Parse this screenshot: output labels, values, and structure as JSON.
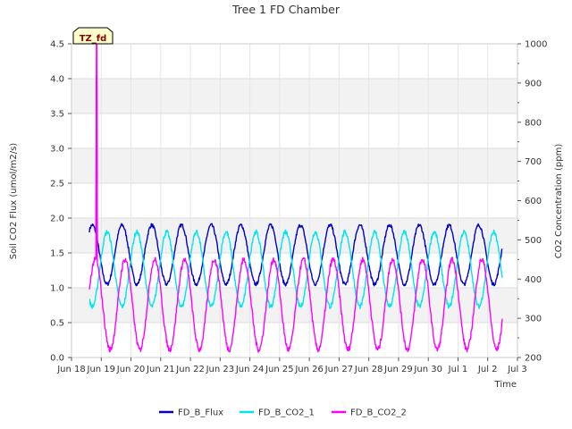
{
  "chart_data": {
    "type": "line",
    "title": "Tree 1 FD Chamber",
    "xlabel": "Time",
    "ylabel_left": "Soil CO2 Flux (umol/m2/s)",
    "ylabel_right": "CO2 Concentration (ppm)",
    "annotation": "TZ_fd",
    "x_range": [
      "Jun 18",
      "Jul 3"
    ],
    "x_tick_labels": [
      "Jun 18",
      "Jun 19",
      "Jun 20",
      "Jun 21",
      "Jun 22",
      "Jun 23",
      "Jun 24",
      "Jun 25",
      "Jun 26",
      "Jun 27",
      "Jun 28",
      "Jun 29",
      "Jun 30",
      "Jul 1",
      "Jul 2",
      "Jul 3"
    ],
    "ylim_left": [
      0,
      4.5
    ],
    "y_ticks_left": [
      "0.0",
      "0.5",
      "1.0",
      "1.5",
      "2.0",
      "2.5",
      "3.0",
      "3.5",
      "4.0",
      "4.5"
    ],
    "ylim_right": [
      200,
      1000
    ],
    "y_ticks_right": [
      "200",
      "300",
      "400",
      "500",
      "600",
      "700",
      "800",
      "900",
      "1000"
    ],
    "grid": true,
    "legend_position": "bottom",
    "series": [
      {
        "name": "FD_B_Flux",
        "axis": "left",
        "color": "#0000cc",
        "start_day": 0.6,
        "end_day": 14.5,
        "daily_min": 1.05,
        "daily_max": 1.9,
        "spike": {
          "day": 0.85,
          "value": 4.03
        }
      },
      {
        "name": "FD_B_CO2_1",
        "axis": "right",
        "color": "#00e5ee",
        "start_day": 0.6,
        "end_day": 14.5,
        "daily_min": 330,
        "daily_max": 520
      },
      {
        "name": "FD_B_CO2_2",
        "axis": "right",
        "color": "#ff00ff",
        "start_day": 0.6,
        "end_day": 14.5,
        "daily_min": 220,
        "daily_max": 450,
        "spike": {
          "day": 0.85,
          "value": 1000
        }
      }
    ]
  }
}
